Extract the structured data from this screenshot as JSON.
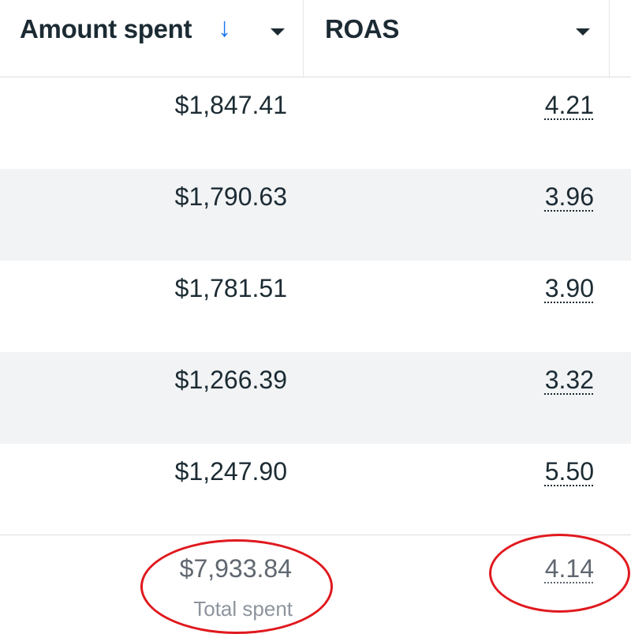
{
  "header": {
    "amount_label": "Amount spent",
    "sort_icon": "arrow-down-icon",
    "roas_label": "ROAS",
    "menu_icon": "caret-down-icon"
  },
  "rows": [
    {
      "amount": "$1,847.41",
      "roas": "4.21"
    },
    {
      "amount": "$1,790.63",
      "roas": "3.96"
    },
    {
      "amount": "$1,781.51",
      "roas": "3.90"
    },
    {
      "amount": "$1,266.39",
      "roas": "3.32"
    },
    {
      "amount": "$1,247.90",
      "roas": "5.50"
    }
  ],
  "totals": {
    "amount": "$7,933.84",
    "amount_label": "Total spent",
    "roas": "4.14"
  },
  "colors": {
    "sort_arrow": "#1877f2",
    "annotation": "#e0191e",
    "alt_row": "#f2f3f5"
  }
}
